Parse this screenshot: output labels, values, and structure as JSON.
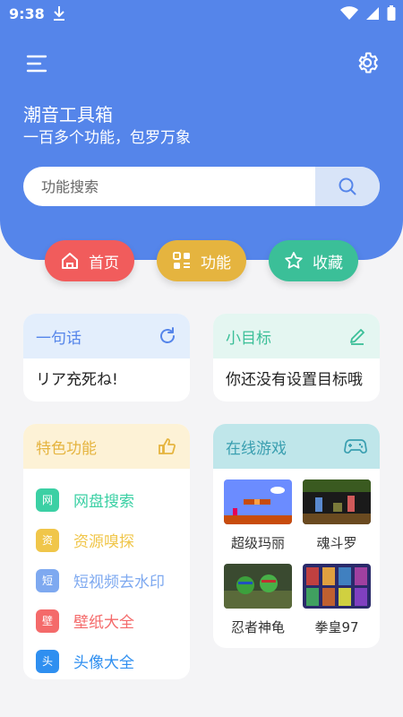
{
  "status_bar": {
    "time": "9:38"
  },
  "header": {
    "title": "潮音工具箱",
    "subtitle": "一百多个功能，包罗万象"
  },
  "search": {
    "placeholder": "功能搜索"
  },
  "nav_pills": [
    {
      "label": "首页",
      "color": "#f15c5c",
      "icon": "home-icon"
    },
    {
      "label": "功能",
      "color": "#e5b43f",
      "icon": "apps-icon"
    },
    {
      "label": "收藏",
      "color": "#3bbf98",
      "icon": "star-icon"
    }
  ],
  "quote_card": {
    "title": "一句话",
    "text": "リア充死ね!",
    "icon": "refresh-icon"
  },
  "goal_card": {
    "title": "小目标",
    "text": "你还没有设置目标哦",
    "icon": "edit-icon"
  },
  "features_card": {
    "title": "特色功能",
    "icon": "thumbs-up-icon",
    "items": [
      {
        "badge": "网",
        "label": "网盘搜索",
        "color": "#3bd0a4"
      },
      {
        "badge": "资",
        "label": "资源嗅探",
        "color": "#f0c64a"
      },
      {
        "badge": "短",
        "label": "短视频去水印",
        "color": "#7ea9f0"
      },
      {
        "badge": "壁",
        "label": "壁纸大全",
        "color": "#f46a6a"
      },
      {
        "badge": "头",
        "label": "头像大全",
        "color": "#2f8ff0"
      }
    ]
  },
  "games_card": {
    "title": "在线游戏",
    "icon": "gamepad-icon",
    "games": [
      {
        "name": "超级玛丽"
      },
      {
        "name": "魂斗罗"
      },
      {
        "name": "忍者神龟"
      },
      {
        "name": "拳皇97"
      }
    ]
  }
}
